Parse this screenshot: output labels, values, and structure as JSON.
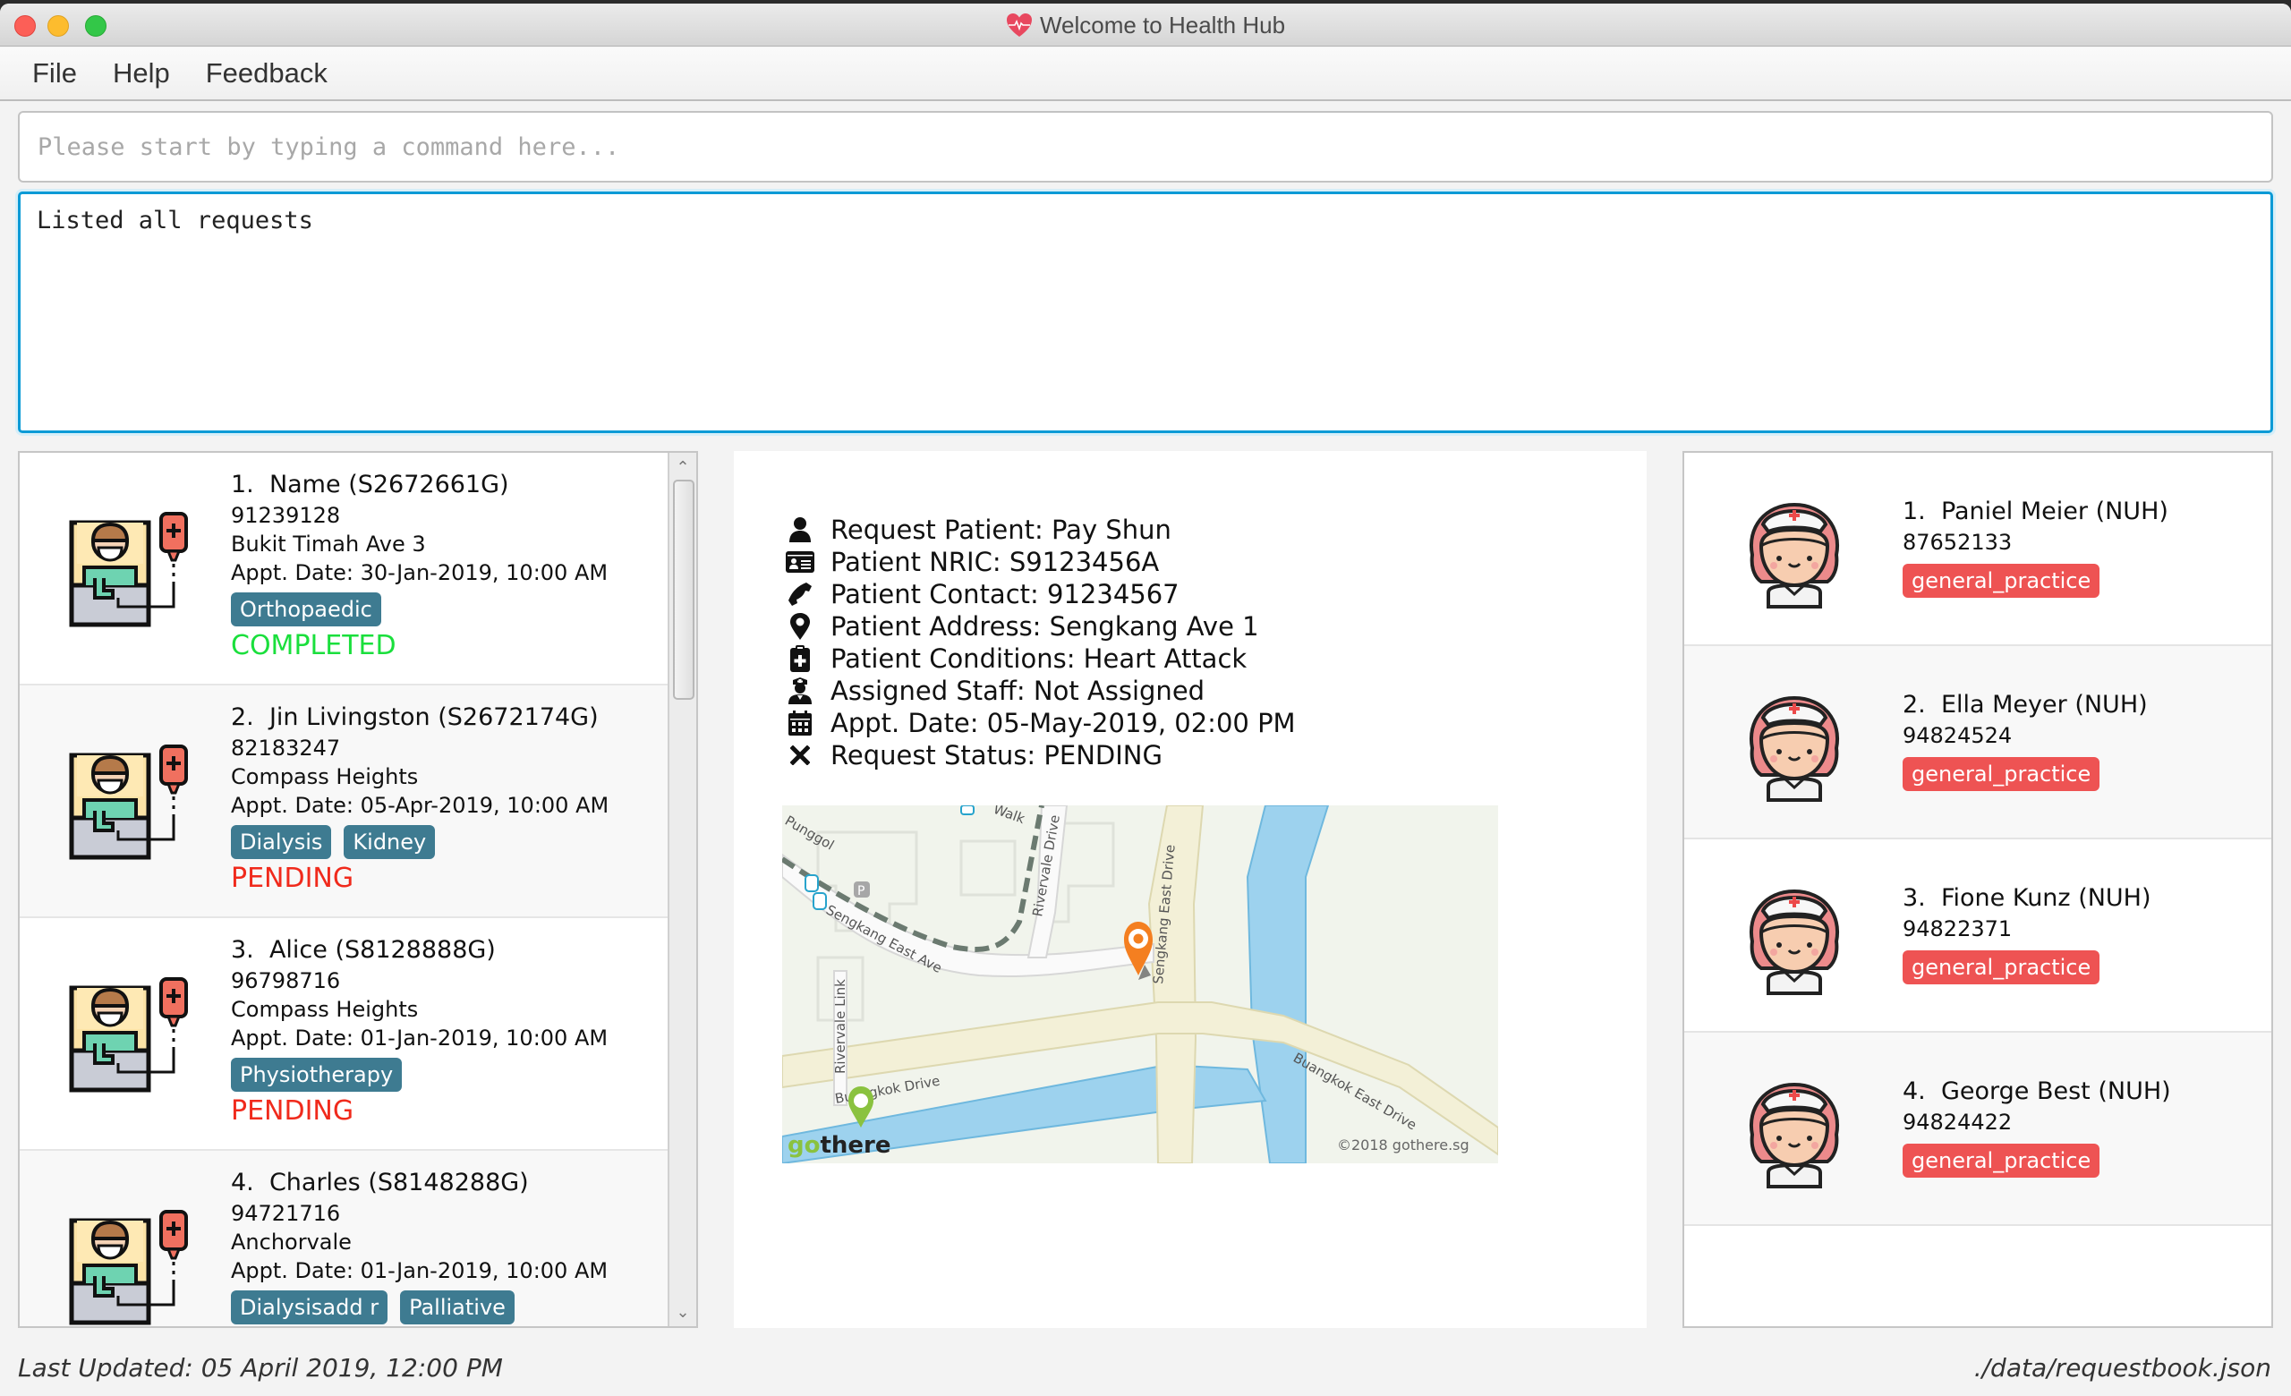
{
  "window": {
    "title": "Welcome to Health Hub",
    "title_icon": "heart-pulse-icon"
  },
  "menu": {
    "items": [
      {
        "label": "File"
      },
      {
        "label": "Help"
      },
      {
        "label": "Feedback"
      }
    ]
  },
  "command": {
    "value": "",
    "placeholder": "Please start by typing a command here..."
  },
  "result": {
    "text": "Listed all requests"
  },
  "colors": {
    "tag_condition": "#3e7b91",
    "tag_specialisation": "#ee5353",
    "status_completed": "#1adf3c",
    "status_pending": "#f02a1c",
    "result_border": "#0b9ad6"
  },
  "requests": [
    {
      "index": "1.",
      "name": "Name",
      "nric": "(S2672661G)",
      "phone": "91239128",
      "address": "Bukit Timah Ave 3",
      "appt": "Appt. Date: 30-Jan-2019, 10:00 AM",
      "tags": [
        "Orthopaedic"
      ],
      "status": "COMPLETED"
    },
    {
      "index": "2.",
      "name": "Jin Livingston",
      "nric": "(S2672174G)",
      "phone": "82183247",
      "address": "Compass Heights",
      "appt": "Appt. Date: 05-Apr-2019, 10:00 AM",
      "tags": [
        "Dialysis",
        "Kidney"
      ],
      "status": "PENDING"
    },
    {
      "index": "3.",
      "name": "Alice",
      "nric": "(S8128888G)",
      "phone": "96798716",
      "address": "Compass Heights",
      "appt": "Appt. Date: 01-Jan-2019, 10:00 AM",
      "tags": [
        "Physiotherapy"
      ],
      "status": "PENDING"
    },
    {
      "index": "4.",
      "name": "Charles",
      "nric": "(S8148288G)",
      "phone": "94721716",
      "address": "Anchorvale",
      "appt": "Appt. Date: 01-Jan-2019, 10:00 AM",
      "tags": [
        "Dialysisadd r",
        "Palliative"
      ],
      "status": ""
    }
  ],
  "detail": {
    "rows": [
      {
        "icon": "user-icon",
        "text": "Request Patient: Pay Shun"
      },
      {
        "icon": "id-card-icon",
        "text": "Patient NRIC: S9123456A"
      },
      {
        "icon": "phone-icon",
        "text": "Patient Contact: 91234567"
      },
      {
        "icon": "map-marker-icon",
        "text": "Patient Address: Sengkang Ave 1"
      },
      {
        "icon": "medical-clipboard-icon",
        "text": "Patient Conditions: Heart Attack"
      },
      {
        "icon": "nurse-icon",
        "text": "Assigned Staff: Not Assigned"
      },
      {
        "icon": "calendar-icon",
        "text": "Appt. Date: 05-May-2019, 02:00 PM"
      },
      {
        "icon": "close-x-icon",
        "text": "Request Status: PENDING"
      }
    ],
    "map": {
      "labels": {
        "road1": "Sengkang East Ave",
        "road2": "Sengkang East Drive",
        "road3": "Rivervale Drive",
        "road4": "Rivervale Link",
        "road5": "Buangkok Drive",
        "road6": "Buangkok East Drive",
        "road7": "Punggol",
        "road8": "Walk"
      },
      "logo": "gothere",
      "copyright": "©2018 gothere.sg"
    }
  },
  "staff": [
    {
      "index": "1.",
      "name": "Paniel Meier",
      "hospital": "(NUH)",
      "phone": "87652133",
      "tag": "general_practice"
    },
    {
      "index": "2.",
      "name": "Ella Meyer",
      "hospital": "(NUH)",
      "phone": "94824524",
      "tag": "general_practice"
    },
    {
      "index": "3.",
      "name": "Fione Kunz",
      "hospital": "(NUH)",
      "phone": "94822371",
      "tag": "general_practice"
    },
    {
      "index": "4.",
      "name": "George Best",
      "hospital": "(NUH)",
      "phone": "94824422",
      "tag": "general_practice"
    }
  ],
  "statusbar": {
    "last_updated": "Last Updated: 05 April 2019, 12:00 PM",
    "file_path": "./data/requestbook.json"
  }
}
